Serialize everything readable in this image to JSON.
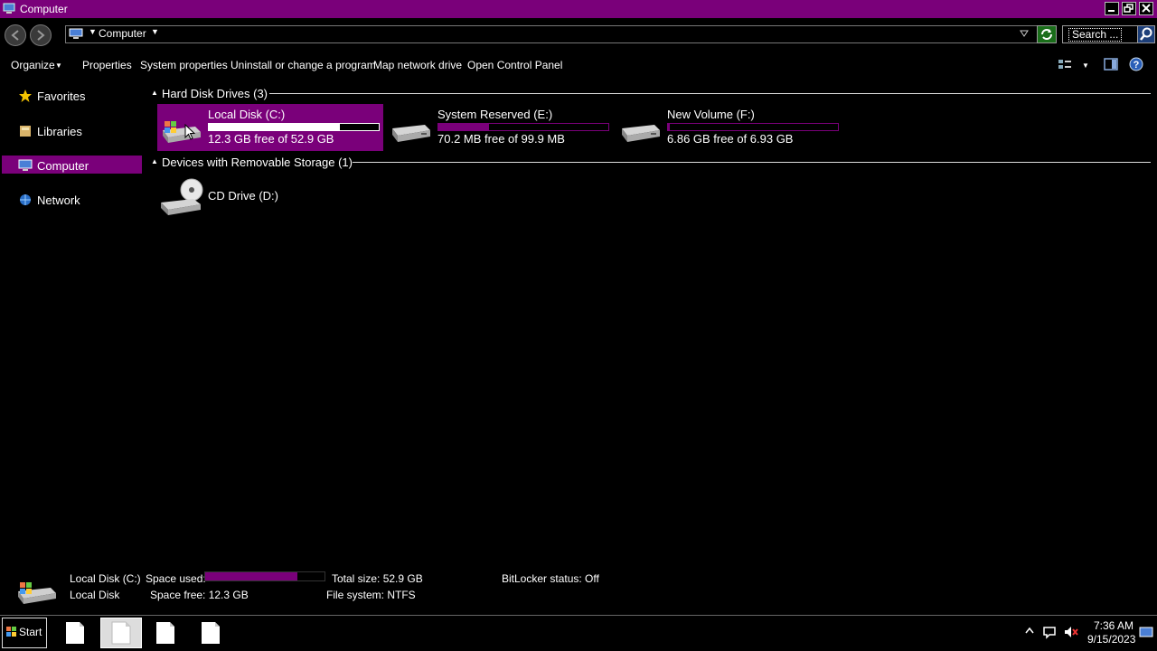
{
  "window": {
    "title": "Computer",
    "accent": "#7a007a"
  },
  "address": {
    "location": "Computer",
    "search_placeholder": "Search ..."
  },
  "toolbar": {
    "organize": "Organize",
    "properties": "Properties",
    "system_properties": "System properties",
    "uninstall": "Uninstall or change a program",
    "map_drive": "Map network drive",
    "control_panel": "Open Control Panel"
  },
  "nav": {
    "favorites": "Favorites",
    "libraries": "Libraries",
    "computer": "Computer",
    "network": "Network"
  },
  "sections": {
    "hdd": "Hard Disk Drives (3)",
    "removable": "Devices with Removable Storage (1)"
  },
  "drives": [
    {
      "name": "Local Disk (C:)",
      "free": "12.3 GB free of 52.9 GB",
      "used_fraction": 0.77
    },
    {
      "name": "System Reserved (E:)",
      "free": "70.2 MB free of 99.9 MB",
      "used_fraction": 0.3
    },
    {
      "name": "New Volume (F:)",
      "free": "6.86 GB free of 6.93 GB",
      "used_fraction": 0.01
    }
  ],
  "removable": [
    {
      "name": "CD Drive (D:)"
    }
  ],
  "details": {
    "name": "Local Disk (C:)",
    "type": "Local Disk",
    "space_used_label": "Space used:",
    "space_used_fraction": 0.77,
    "space_free": "Space free: 12.3 GB",
    "total_size": "Total size: 52.9 GB",
    "file_system": "File system: NTFS",
    "bitlocker": "BitLocker status: Off"
  },
  "taskbar": {
    "start": "Start",
    "time": "7:36 AM",
    "date": "9/15/2023"
  }
}
